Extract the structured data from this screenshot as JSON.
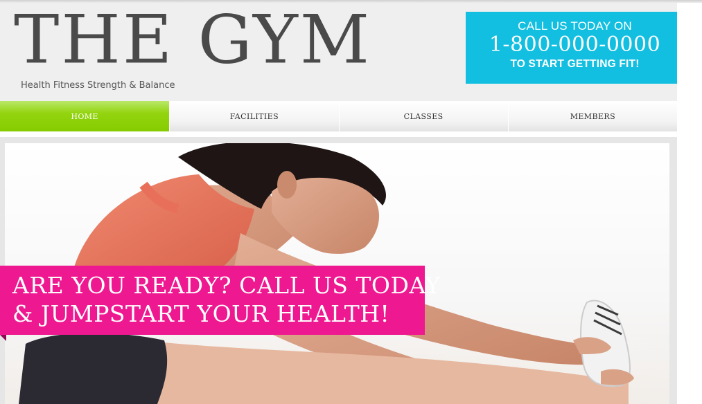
{
  "header": {
    "logo": "THE GYM",
    "tagline": "Health Fitness Strength & Balance"
  },
  "cta": {
    "line1": "CALL US TODAY ON",
    "phone": "1-800-000-0000",
    "line3": "TO START GETTING FIT!",
    "color": "#13bfe0"
  },
  "nav": {
    "items": [
      {
        "label": "HOME"
      },
      {
        "label": "FACILITIES"
      },
      {
        "label": "CLASSES"
      },
      {
        "label": "MEMBERS"
      }
    ],
    "active_color": "#86cc00"
  },
  "hero": {
    "banner_line1": "ARE YOU READY? CALL US TODAY",
    "banner_line2": "& JUMPSTART YOUR HEALTH!",
    "banner_color": "#ee1990",
    "photo": "woman-stretching-photo"
  }
}
